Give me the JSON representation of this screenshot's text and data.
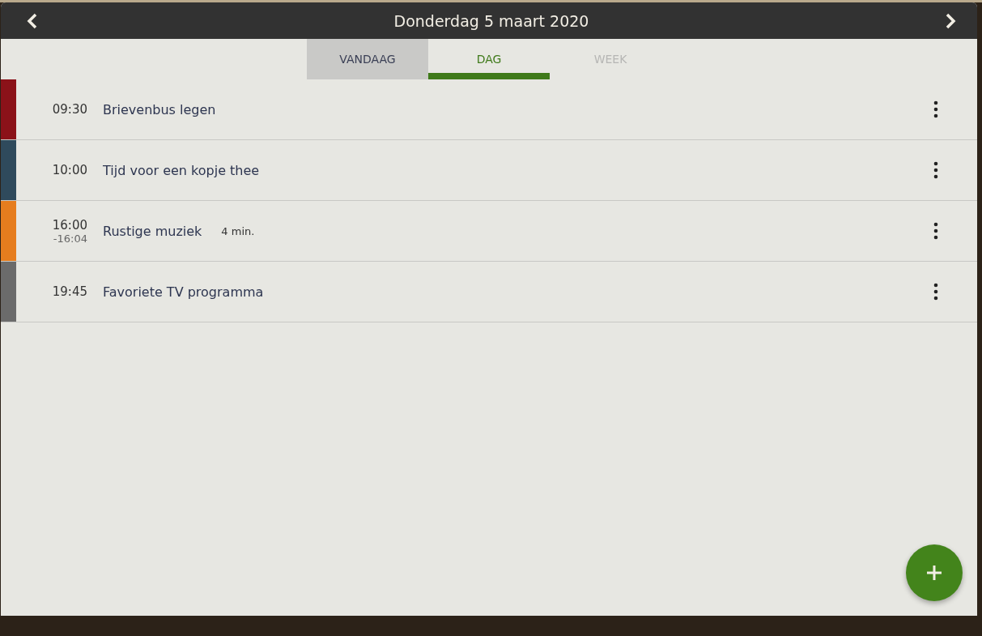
{
  "header": {
    "title": "Donderdag 5 maart 2020"
  },
  "tabs": [
    {
      "label": "VANDAAG",
      "selected": false,
      "highlighted": true,
      "disabled": false
    },
    {
      "label": "DAG",
      "selected": true,
      "highlighted": false,
      "disabled": false
    },
    {
      "label": "WEEK",
      "selected": false,
      "highlighted": false,
      "disabled": true
    }
  ],
  "events": [
    {
      "time": "09:30",
      "title": "Brievenbus legen",
      "color": "#8b1219"
    },
    {
      "time": "10:00",
      "title": "Tijd voor een kopje thee",
      "color": "#2f4a5c"
    },
    {
      "time": "16:00",
      "end_time": "-16:04",
      "title": "Rustige muziek",
      "duration": "4 min.",
      "color": "#e67d1e"
    },
    {
      "time": "19:45",
      "title": "Favoriete TV programma",
      "color": "#6b6b6b"
    }
  ]
}
